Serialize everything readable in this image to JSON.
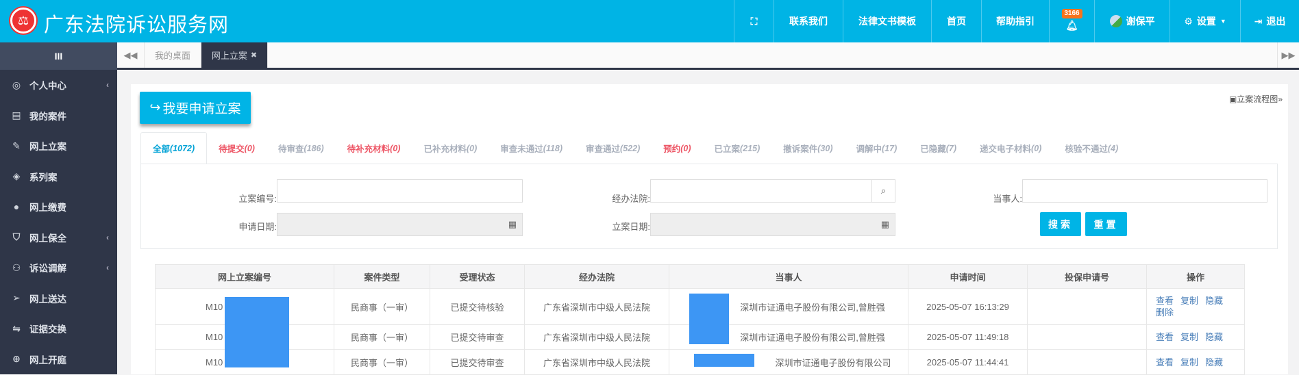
{
  "header": {
    "logo_text": "法",
    "title": "广东法院诉讼服务网",
    "nav": [
      {
        "label": "",
        "icon": "fullscreen-icon"
      },
      {
        "label": "联系我们"
      },
      {
        "label": "法律文书模板"
      },
      {
        "label": "首页"
      },
      {
        "label": "帮助指引"
      },
      {
        "label": "",
        "icon": "bell-icon",
        "badge": "3166"
      },
      {
        "label": "谢保平",
        "icon": "avatar-icon"
      },
      {
        "label": "设置",
        "icon": "gear-icon"
      },
      {
        "label": "退出",
        "icon": "logout-icon"
      }
    ]
  },
  "sidebar": {
    "toggle": "III",
    "items": [
      {
        "label": "个人中心",
        "icon": "user-circle-icon",
        "chevron": true
      },
      {
        "label": "我的案件",
        "icon": "document-icon"
      },
      {
        "label": "网上立案",
        "icon": "edit-icon"
      },
      {
        "label": "系列案",
        "icon": "layers-icon"
      },
      {
        "label": "网上缴费",
        "icon": "payment-icon"
      },
      {
        "label": "网上保全",
        "icon": "shield-icon",
        "chevron": true
      },
      {
        "label": "诉讼调解",
        "icon": "people-icon",
        "chevron": true
      },
      {
        "label": "网上送达",
        "icon": "send-icon"
      },
      {
        "label": "证据交换",
        "icon": "exchange-icon"
      },
      {
        "label": "网上开庭",
        "icon": "globe-icon"
      }
    ]
  },
  "tabbar": {
    "tabs": [
      {
        "label": "我的桌面"
      },
      {
        "label": "网上立案",
        "active": true
      }
    ]
  },
  "main": {
    "apply_button": "我要申请立案",
    "flow_chart": "立案流程图",
    "status_tabs": [
      {
        "label": "全部",
        "count": "(1072)",
        "color": "#00a2d6"
      },
      {
        "label": "待提交",
        "count": "(0)",
        "color": "#ed5565"
      },
      {
        "label": "待审查",
        "count": "(186)",
        "color": "#a9b0bc"
      },
      {
        "label": "待补充材料",
        "count": "(0)",
        "color": "#ed5565"
      },
      {
        "label": "已补充材料",
        "count": "(0)",
        "color": "#a9b0bc"
      },
      {
        "label": "审查未通过",
        "count": "(118)",
        "color": "#a9b0bc"
      },
      {
        "label": "审查通过",
        "count": "(522)",
        "color": "#a9b0bc"
      },
      {
        "label": "预约",
        "count": "(0)",
        "color": "#ed5565"
      },
      {
        "label": "已立案",
        "count": "(215)",
        "color": "#a9b0bc"
      },
      {
        "label": "撤诉案件",
        "count": "(30)",
        "color": "#a9b0bc"
      },
      {
        "label": "调解中",
        "count": "(17)",
        "color": "#a9b0bc"
      },
      {
        "label": "已隐藏",
        "count": "(7)",
        "color": "#a9b0bc"
      },
      {
        "label": "递交电子材料",
        "count": "(0)",
        "color": "#a9b0bc"
      },
      {
        "label": "核验不通过",
        "count": "(4)",
        "color": "#a9b0bc"
      }
    ],
    "form": {
      "case_no": "立案编号:",
      "court": "经办法院:",
      "party": "当事人:",
      "apply_date": "申请日期:",
      "file_date": "立案日期:",
      "search": "搜索",
      "reset": "重置"
    },
    "table": {
      "headers": [
        "网上立案编号",
        "案件类型",
        "受理状态",
        "经办法院",
        "当事人",
        "申请时间",
        "投保申请号",
        "操作"
      ],
      "rows": [
        {
          "id": "M10",
          "type": "民商事（一审）",
          "status": "已提交待核验",
          "court": "广东省深圳市中级人民法院",
          "party": "深圳市证通电子股份有限公司,曾胜强",
          "time": "2025-05-07 16:13:29",
          "ins": "",
          "actions": [
            "查看",
            "复制",
            "隐藏",
            "删除"
          ]
        },
        {
          "id": "M10",
          "type": "民商事（一审）",
          "status": "已提交待审查",
          "court": "广东省深圳市中级人民法院",
          "party": "深圳市证通电子股份有限公司,曾胜强",
          "time": "2025-05-07 11:49:18",
          "ins": "",
          "actions": [
            "查看",
            "复制",
            "隐藏"
          ]
        },
        {
          "id": "M10",
          "type": "民商事（一审）",
          "status": "已提交待审查",
          "court": "广东省深圳市中级人民法院",
          "party": "深圳市证通电子股份有限公司",
          "time": "2025-05-07 11:44:41",
          "ins": "",
          "actions": [
            "查看",
            "复制",
            "隐藏"
          ]
        }
      ]
    }
  }
}
